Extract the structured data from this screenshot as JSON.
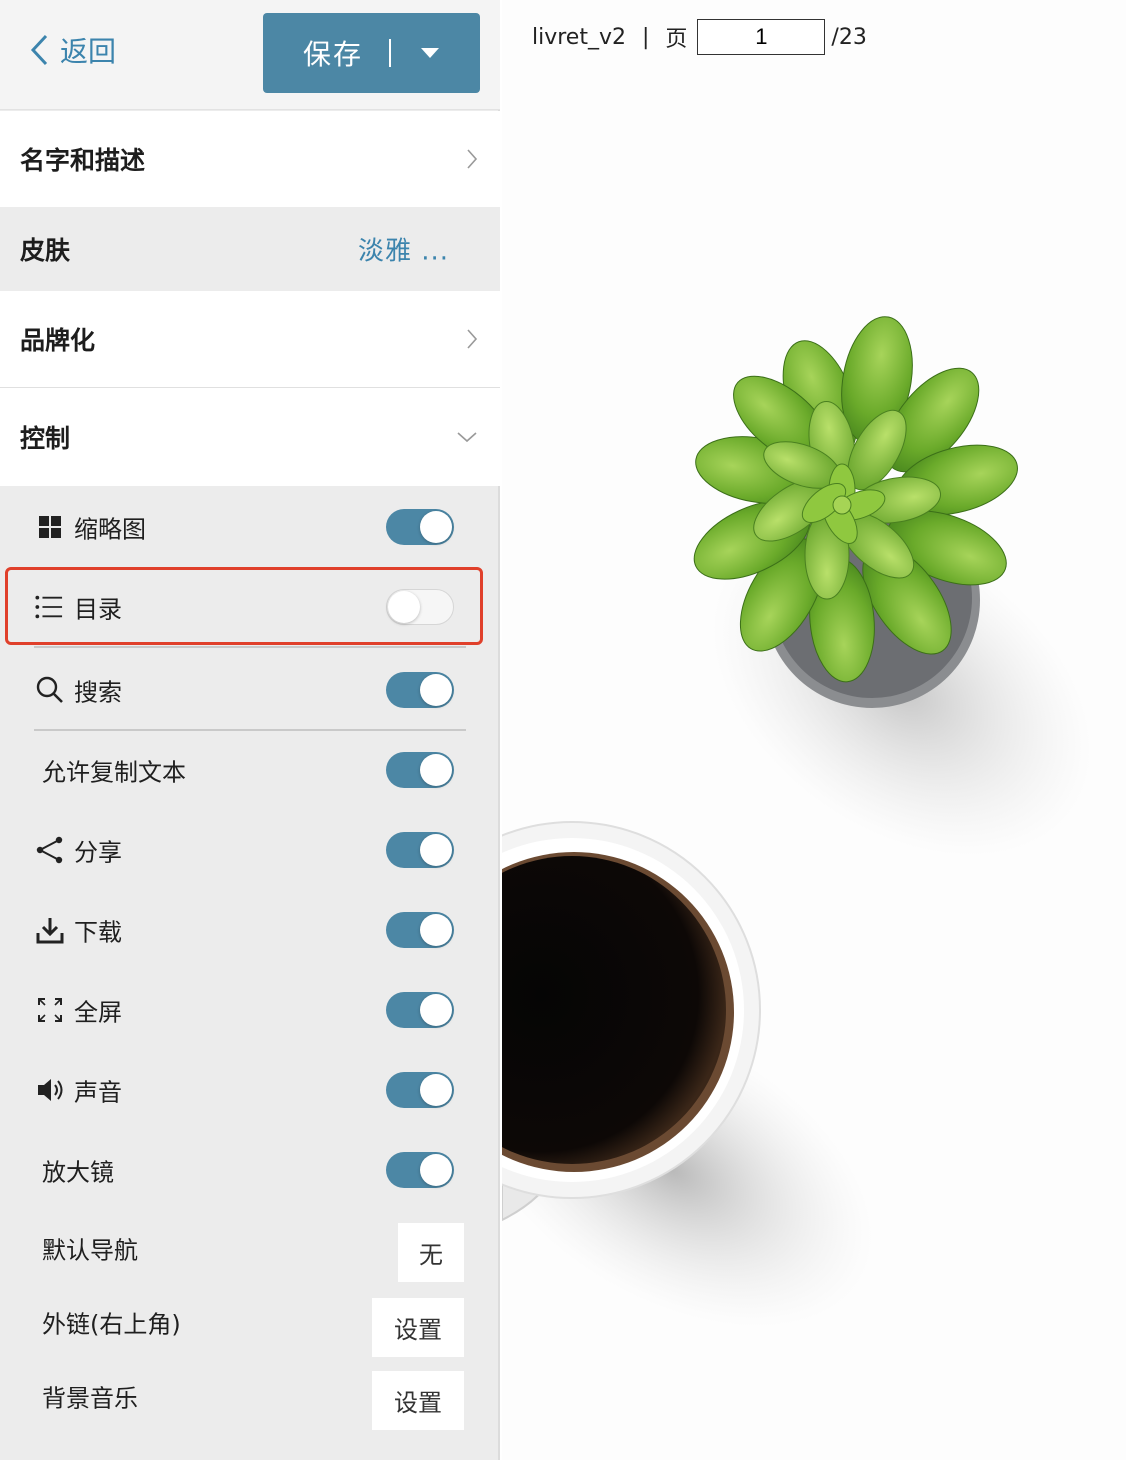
{
  "header": {
    "back_label": "返回",
    "save_label": "保存"
  },
  "sections": {
    "name_desc": "名字和描述",
    "skin": "皮肤",
    "skin_value": "淡雅 ...",
    "branding": "品牌化",
    "controls": "控制"
  },
  "controls": {
    "thumbnails": {
      "label": "缩略图",
      "icon": "grid-icon",
      "enabled": true
    },
    "toc": {
      "label": "目录",
      "icon": "list-icon",
      "enabled": false
    },
    "search": {
      "label": "搜索",
      "icon": "search-icon",
      "enabled": true
    },
    "copy_text": {
      "label": "允许复制文本",
      "enabled": true
    },
    "share": {
      "label": "分享",
      "icon": "share-icon",
      "enabled": true
    },
    "download": {
      "label": "下载",
      "icon": "download-icon",
      "enabled": true
    },
    "fullscreen": {
      "label": "全屏",
      "icon": "fullscreen-icon",
      "enabled": true
    },
    "sound": {
      "label": "声音",
      "icon": "speaker-icon",
      "enabled": true
    },
    "magnifier": {
      "label": "放大镜",
      "enabled": true
    }
  },
  "options": {
    "default_nav": {
      "label": "默认导航",
      "value": "无"
    },
    "external_link": {
      "label": "外链(右上角)",
      "button": "设置"
    },
    "bg_music": {
      "label": "背景音乐",
      "button": "设置"
    }
  },
  "viewer": {
    "doc_name": "livret_v2",
    "separator": "|",
    "page_label": "页",
    "current_page": "1",
    "total_pages": "/23"
  },
  "colors": {
    "accent": "#4c87a5",
    "link": "#3c84ad",
    "highlight_border": "#e0402b",
    "sidebar_bg": "#ececec"
  }
}
